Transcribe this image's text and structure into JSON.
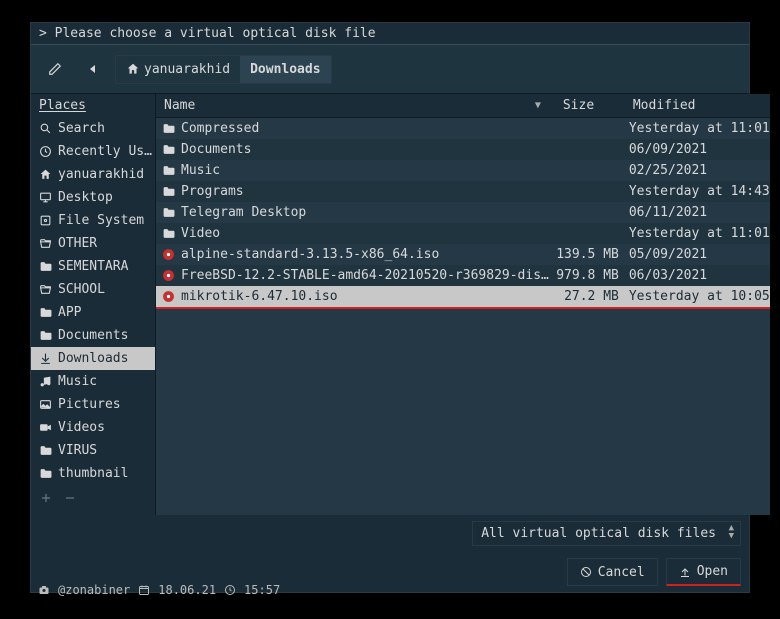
{
  "title": "> Please choose a virtual optical disk file",
  "breadcrumb": {
    "home_label": "yanuarakhid",
    "current": "Downloads"
  },
  "sidebar": {
    "header": "Places",
    "items": [
      {
        "icon": "search-icon",
        "label": "Search"
      },
      {
        "icon": "clock-icon",
        "label": "Recently Us…"
      },
      {
        "icon": "home-icon",
        "label": "yanuarakhid"
      },
      {
        "icon": "desktop-icon",
        "label": "Desktop"
      },
      {
        "icon": "disk-icon",
        "label": "File System"
      },
      {
        "icon": "folder-open-icon",
        "label": "OTHER"
      },
      {
        "icon": "folder-icon",
        "label": "SEMENTARA"
      },
      {
        "icon": "folder-open-icon",
        "label": "SCHOOL"
      },
      {
        "icon": "folder-icon",
        "label": "APP"
      },
      {
        "icon": "folder-icon",
        "label": "Documents"
      },
      {
        "icon": "download-icon",
        "label": "Downloads"
      },
      {
        "icon": "music-icon",
        "label": "Music"
      },
      {
        "icon": "image-icon",
        "label": "Pictures"
      },
      {
        "icon": "video-icon",
        "label": "Videos"
      },
      {
        "icon": "folder-icon",
        "label": "VIRUS"
      },
      {
        "icon": "folder-icon",
        "label": "thumbnail"
      }
    ],
    "active_index": 10
  },
  "columns": {
    "name": "Name",
    "size": "Size",
    "modified": "Modified"
  },
  "files": [
    {
      "type": "folder",
      "name": "Compressed",
      "size": "",
      "modified": "Yesterday at 11:01"
    },
    {
      "type": "folder",
      "name": "Documents",
      "size": "",
      "modified": "06/09/2021"
    },
    {
      "type": "folder",
      "name": "Music",
      "size": "",
      "modified": "02/25/2021"
    },
    {
      "type": "folder",
      "name": "Programs",
      "size": "",
      "modified": "Yesterday at 14:43"
    },
    {
      "type": "folder",
      "name": "Telegram Desktop",
      "size": "",
      "modified": "06/11/2021"
    },
    {
      "type": "folder",
      "name": "Video",
      "size": "",
      "modified": "Yesterday at 11:01"
    },
    {
      "type": "iso",
      "name": "alpine-standard-3.13.5-x86_64.iso",
      "size": "139.5 MB",
      "modified": "05/09/2021"
    },
    {
      "type": "iso",
      "name": "FreeBSD-12.2-STABLE-amd64-20210520-r369829-dis…",
      "size": "979.8 MB",
      "modified": "06/03/2021"
    },
    {
      "type": "iso",
      "name": "mikrotik-6.47.10.iso",
      "size": "27.2 MB",
      "modified": "Yesterday at 10:05"
    }
  ],
  "selected_index": 8,
  "filter": "All virtual optical disk files",
  "buttons": {
    "cancel": "Cancel",
    "open": "Open"
  },
  "status": {
    "user": "@zonabiner",
    "date": "18.06.21",
    "time": "15:57"
  }
}
